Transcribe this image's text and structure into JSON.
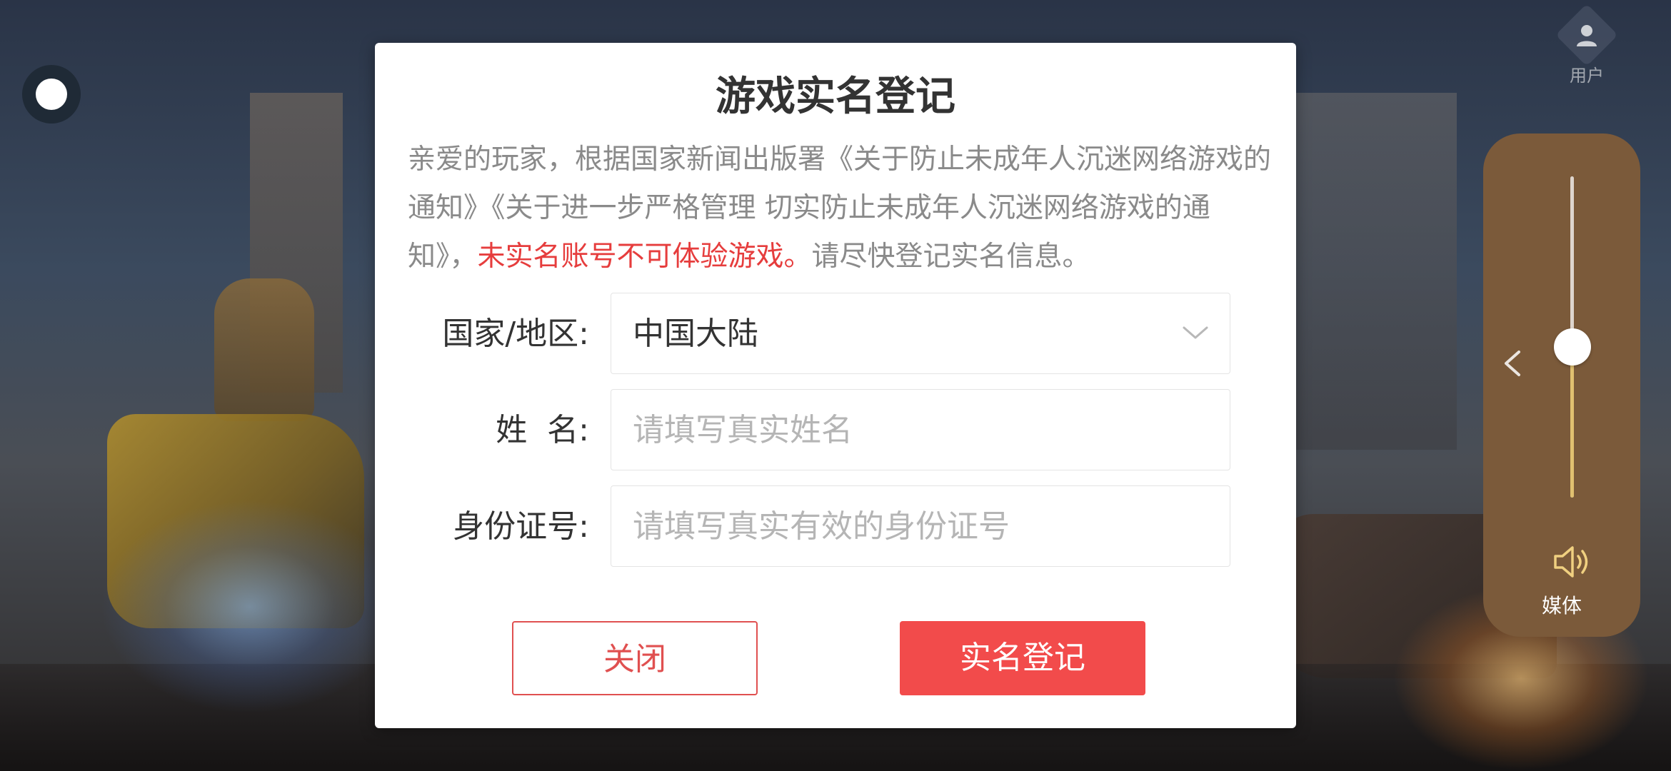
{
  "background": {
    "description_icon": "racing-game-scene"
  },
  "overlay": {
    "record_icon": "record-dot-icon",
    "user_icon": "user-icon",
    "user_label": "用户"
  },
  "volume": {
    "level_fraction": 0.47,
    "back_icon": "chevron-left-icon",
    "speaker_icon": "speaker-icon",
    "label": "媒体",
    "accent_color": "#e0c070",
    "panel_color": "#7b5a3a"
  },
  "dialog": {
    "title": "游戏实名登记",
    "notice_prefix": "亲爱的玩家，根据国家新闻出版署《关于防止未成年人沉迷网络游戏的通知》《关于进一步严格管理 切实防止未成年人沉迷网络游戏的通知》，",
    "notice_warning": "未实名账号不可体验游戏。",
    "notice_suffix": "请尽快登记实名信息。",
    "warning_color": "#e63d3d",
    "fields": {
      "region": {
        "label": "国家/地区:",
        "value": "中国大陆",
        "icon": "chevron-down-icon"
      },
      "name": {
        "label": "姓  名:",
        "placeholder": "请填写真实姓名",
        "value": ""
      },
      "id_number": {
        "label": "身份证号:",
        "placeholder": "请填写真实有效的身份证号",
        "value": ""
      }
    },
    "buttons": {
      "close": "关闭",
      "submit": "实名登记"
    },
    "primary_color": "#f24b4b"
  }
}
